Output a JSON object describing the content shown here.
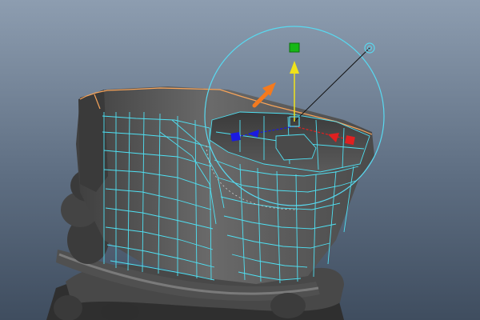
{
  "app": {
    "view": "perspective-viewport",
    "background_top": "#8d9db0",
    "background_bottom": "#3f4d5f"
  },
  "selection": {
    "mode": "component-edges",
    "wire_color": "#4fe0f2",
    "highlight_color": "#f7a45a"
  },
  "manipulator": {
    "type": "universal-transform",
    "axis_x_color": "#e02020",
    "axis_y_color": "#16b816",
    "axis_z_color": "#1a1ae0",
    "rotate_ring_color": "#58d9f0",
    "active_arrow_color": "#f0e21a"
  },
  "annotation": {
    "arrow_icon": "orange-arrow-icon",
    "arrow_color": "#f47a1e"
  },
  "mesh": {
    "name": "cuff-mesh",
    "body_color": "#565656",
    "dark_color": "#2e2e2e",
    "lower_color": "#3a3a3a"
  }
}
